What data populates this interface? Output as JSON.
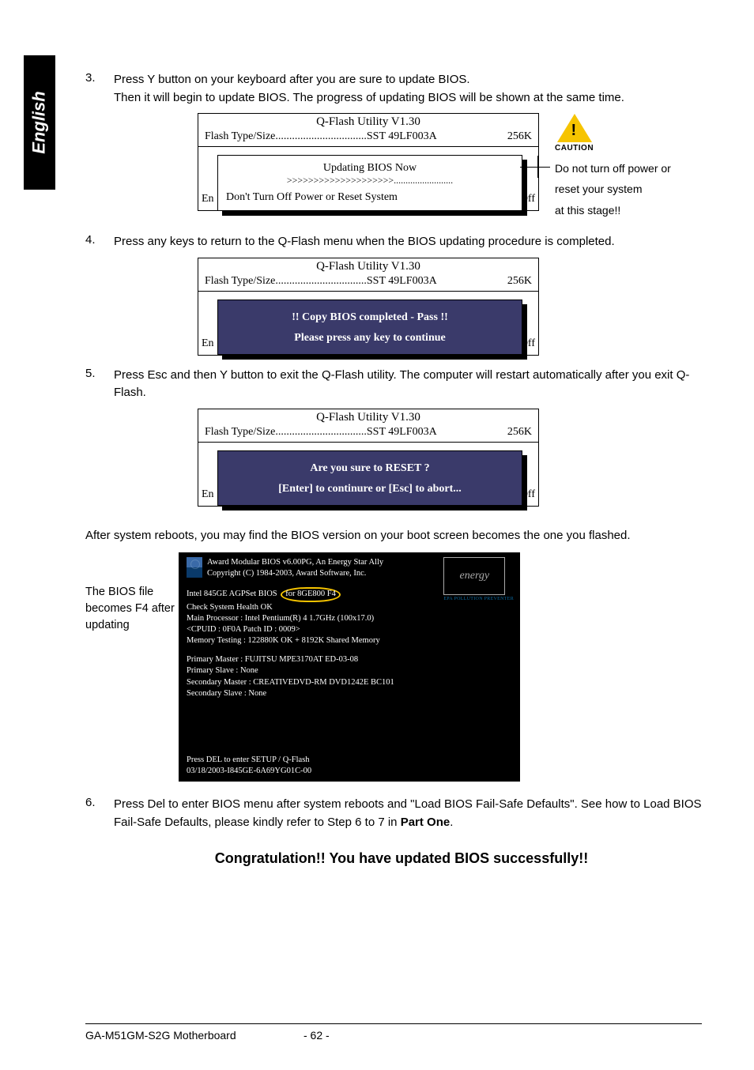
{
  "sideTab": "English",
  "step3": {
    "num": "3.",
    "text1": "Press Y button on your keyboard after you are sure to update BIOS.",
    "text2": "Then it will begin to update BIOS. The progress of updating BIOS will be shown at the same time."
  },
  "qbox1": {
    "title": "Q-Flash Utility V1.30",
    "flashLabel": "Flash Type/Size.................................SST 49LF003A",
    "size": "256K",
    "innerTitle": "Updating BIOS Now",
    "progress": ">>>>>>>>>>>>>>>>>>>>.........................",
    "warn": "Don't Turn Off Power or Reset System",
    "behindL": "En",
    "behindR": "er Off"
  },
  "caution": {
    "label": "CAUTION",
    "line1": "Do not turn off power or",
    "line2": "reset your system",
    "line3": "at this stage!!"
  },
  "step4": {
    "num": "4.",
    "text": "Press any keys to return to the Q-Flash menu when the BIOS updating procedure is completed."
  },
  "qbox2": {
    "title": "Q-Flash Utility V1.30",
    "flashLabel": "Flash Type/Size.................................SST 49LF003A",
    "size": "256K",
    "l1": "!! Copy BIOS completed - Pass !!",
    "l2": "Please press any key to continue",
    "behindL": "En",
    "behindR": "er Off"
  },
  "step5": {
    "num": "5.",
    "text": "Press Esc and then Y button to exit the Q-Flash utility. The computer will restart automatically after you exit Q-Flash."
  },
  "qbox3": {
    "title": "Q-Flash Utility V1.30",
    "flashLabel": "Flash Type/Size.................................SST 49LF003A",
    "size": "256K",
    "l1": "Are you sure to RESET ?",
    "l2": "[Enter] to continure or [Esc] to abort...",
    "behindL": "En",
    "behindR": "er Off"
  },
  "afterReboot": "After system reboots, you may find the BIOS version on your boot screen becomes the one you flashed.",
  "bootAnnot": "The BIOS file becomes F4 after updating",
  "boot": {
    "l1": "Award Modular BIOS v6.00PG, An Energy Star Ally",
    "l2": "Copyright  (C) 1984-2003, Award Software,  Inc.",
    "l3a": "Intel 845GE AGPSet BIOS ",
    "l3b": "for 8GE800 F4",
    "l4": "Check System Health OK",
    "l5": "Main Processor : Intel Pentium(R) 4   1.7GHz (100x17.0)",
    "l6": "<CPUID : 0F0A Patch ID  : 0009>",
    "l7": "Memory Testing   :  122880K OK + 8192K Shared Memory",
    "l8": "Primary Master : FUJITSU MPE3170AT ED-03-08",
    "l9": "Primary Slave : None",
    "l10": "Secondary Master : CREATIVEDVD-RM DVD1242E BC101",
    "l11": "Secondary Slave : None",
    "l12": "Press DEL to enter SETUP / Q-Flash",
    "l13": "03/18/2003-I845GE-6A69YG01C-00",
    "energy": "energy",
    "epa": "EPA   POLLUTION  PREVENTER"
  },
  "step6": {
    "num": "6.",
    "text1": "Press Del to enter BIOS menu after system reboots and \"Load BIOS Fail-Safe Defaults\". See how to Load BIOS Fail-Safe Defaults, please kindly refer to Step 6 to 7 in ",
    "bold": "Part One",
    "text2": "."
  },
  "congrats": "Congratulation!! You have updated BIOS successfully!!",
  "footer": {
    "left": "GA-M51GM-S2G Motherboard",
    "center": "- 62 -"
  }
}
